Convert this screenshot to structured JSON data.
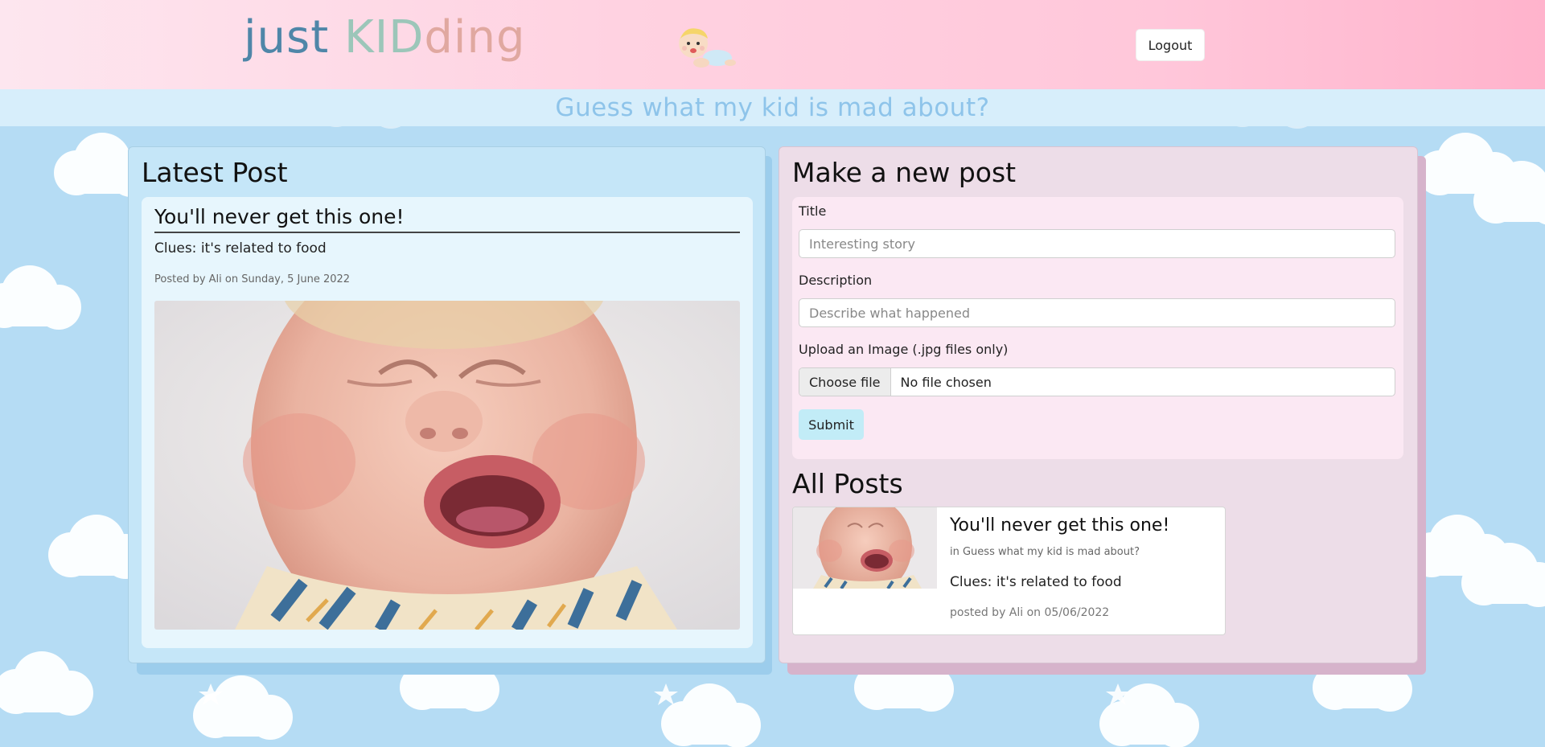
{
  "header": {
    "brand_part1": "just",
    "brand_part2": "KID",
    "brand_part3": "ding",
    "logout_label": "Logout"
  },
  "tagline": "Guess what my kid is mad about?",
  "latest": {
    "heading": "Latest Post",
    "title": "You'll never get this one!",
    "clues": "Clues: it's related to food",
    "meta": "Posted by Ali on Sunday, 5 June 2022"
  },
  "form": {
    "heading": "Make a new post",
    "title_label": "Title",
    "title_placeholder": "Interesting story",
    "description_label": "Description",
    "description_placeholder": "Describe what happened",
    "upload_label": "Upload an Image (.jpg files only)",
    "choose_file_label": "Choose file",
    "file_status": "No file chosen",
    "submit_label": "Submit"
  },
  "all_posts": {
    "heading": "All Posts",
    "items": [
      {
        "title": "You'll never get this one!",
        "category": "in Guess what my kid is mad about?",
        "clues": "Clues: it's related to food",
        "meta": "posted by Ali on 05/06/2022"
      }
    ]
  },
  "colors": {
    "sky": "#b5dcf4",
    "header_pink": "#ffc7da",
    "left_panel": "#c5e6f8",
    "right_panel": "#eddde8",
    "submit_bg": "#c2ecf7"
  }
}
